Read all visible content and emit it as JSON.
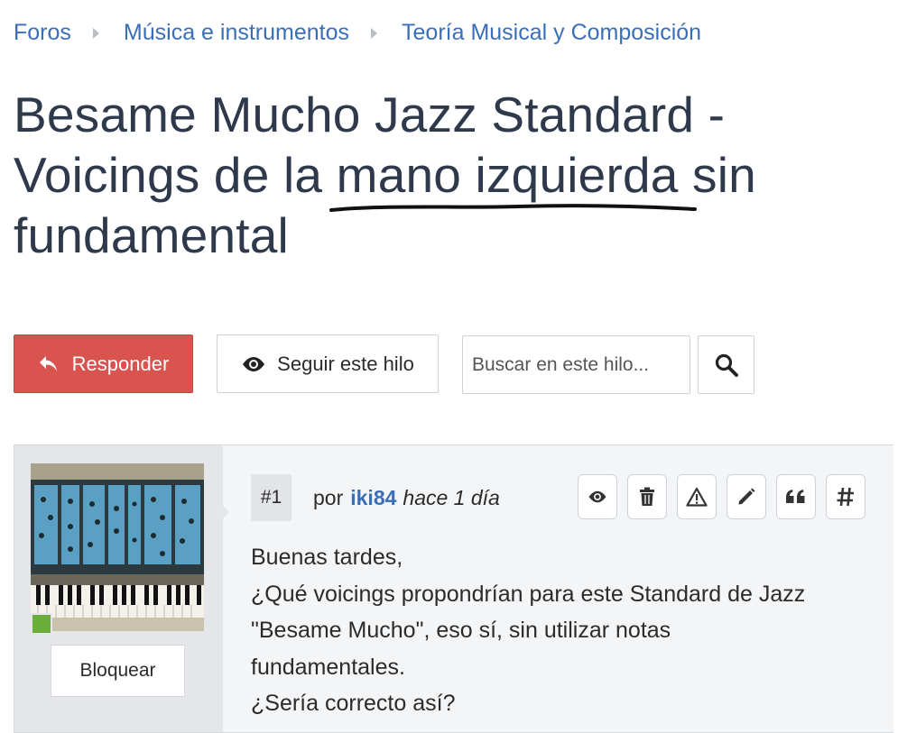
{
  "breadcrumb": {
    "items": [
      {
        "label": "Foros"
      },
      {
        "label": "Música e instrumentos"
      },
      {
        "label": "Teoría Musical y Composición"
      }
    ]
  },
  "thread": {
    "title_lines": [
      "Besame Mucho Jazz Standard -",
      "Voicings de la mano izquierda sin",
      "fundamental"
    ]
  },
  "actions": {
    "reply_label": "Responder",
    "follow_label": "Seguir este hilo",
    "search_placeholder": "Buscar en este hilo..."
  },
  "post": {
    "number": "#1",
    "by": "por",
    "author": "iki84",
    "time": "hace 1 día",
    "block_label": "Bloquear",
    "body_lines": [
      "Buenas tardes,",
      "¿Qué voicings propondrían para este Standard de Jazz",
      "\"Besame Mucho\", eso sí, sin utilizar notas",
      "fundamentales.",
      "¿Sería correcto así?"
    ],
    "tools": [
      "eye-icon",
      "trash-icon",
      "warning-icon",
      "pencil-icon",
      "quote-icon",
      "hash-icon"
    ]
  },
  "colors": {
    "link": "#3a6fb7",
    "reply_button": "#d9534f",
    "title": "#2e3a4b",
    "online": "#6aae3b"
  }
}
